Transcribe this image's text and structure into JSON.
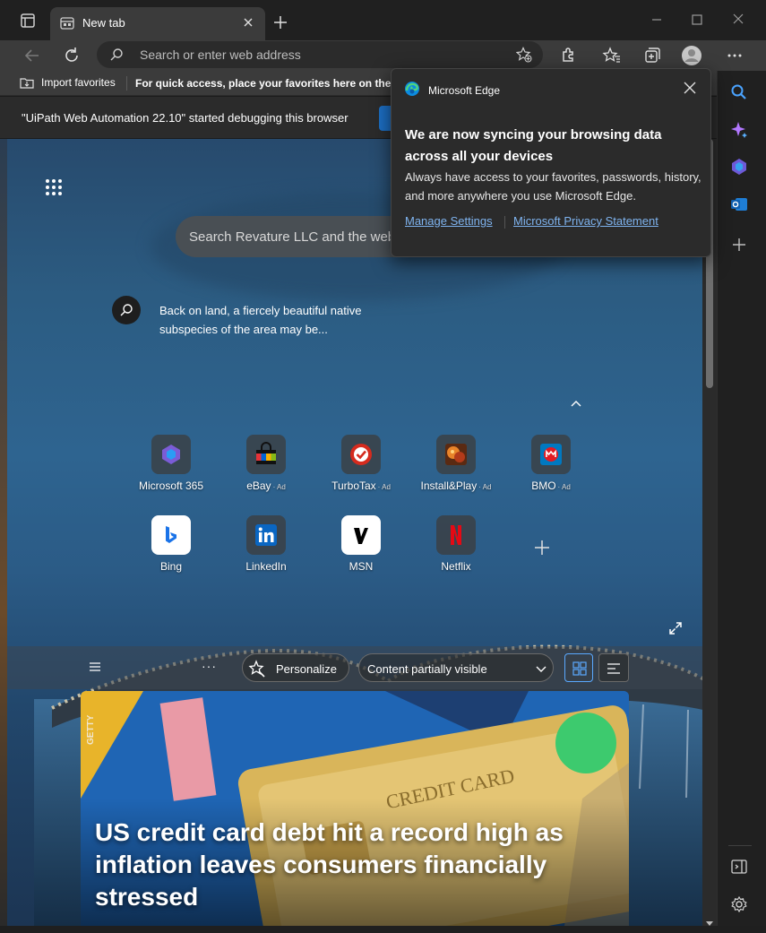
{
  "window": {
    "tab_title": "New tab",
    "new_tab_symbol": "+"
  },
  "address_bar": {
    "placeholder": "Search or enter web address"
  },
  "favorites_bar": {
    "import_label": "Import favorites",
    "hint": "For quick access, place your favorites here on the favorites bar."
  },
  "infobar": {
    "message": "\"UiPath Web Automation 22.10\" started debugging this browser"
  },
  "page": {
    "search_placeholder": "Search Revature LLC and the web",
    "image_info": "Back on land, a fiercely beautiful native subspecies of the area may be..."
  },
  "quick_links": [
    {
      "label": "Microsoft 365",
      "ad": "",
      "icon": "microsoft-365-icon",
      "color": "#7b5cd6"
    },
    {
      "label": "eBay",
      "ad": "Ad",
      "icon": "ebay-icon",
      "color": "#e53238"
    },
    {
      "label": "TurboTax",
      "ad": "Ad",
      "icon": "turbotax-icon",
      "color": "#d52b1e"
    },
    {
      "label": "Install&Play",
      "ad": "Ad",
      "icon": "install-play-icon",
      "color": "#a0521a"
    },
    {
      "label": "BMO",
      "ad": "Ad",
      "icon": "bmo-icon",
      "color": "#0079c1"
    },
    {
      "label": "Bing",
      "ad": "",
      "icon": "bing-icon",
      "color": "#1a73e8"
    },
    {
      "label": "LinkedIn",
      "ad": "",
      "icon": "linkedin-icon",
      "color": "#0a66c2"
    },
    {
      "label": "MSN",
      "ad": "",
      "icon": "msn-icon",
      "color": "#000000"
    },
    {
      "label": "Netflix",
      "ad": "",
      "icon": "netflix-icon",
      "color": "#e50914"
    }
  ],
  "feed_bar": {
    "more": "···",
    "personalize": "Personalize",
    "visibility": "Content partially visible"
  },
  "news": {
    "source": "GETTY",
    "headline": "US credit card debt hit a record high as inflation leaves consumers financially stressed",
    "card_text": "CREDIT CARD"
  },
  "popup": {
    "brand": "Microsoft Edge",
    "title": "We are now syncing your browsing data across all your devices",
    "body": "Always have access to your favorites, passwords, history, and more anywhere you use Microsoft Edge.",
    "link_settings": "Manage Settings",
    "link_privacy": "Microsoft Privacy Statement"
  },
  "colors": {
    "accent": "#1c6ec2",
    "link": "#7fb4f0",
    "chrome_dark": "#202020",
    "chrome_mid": "#3b3b3b"
  }
}
